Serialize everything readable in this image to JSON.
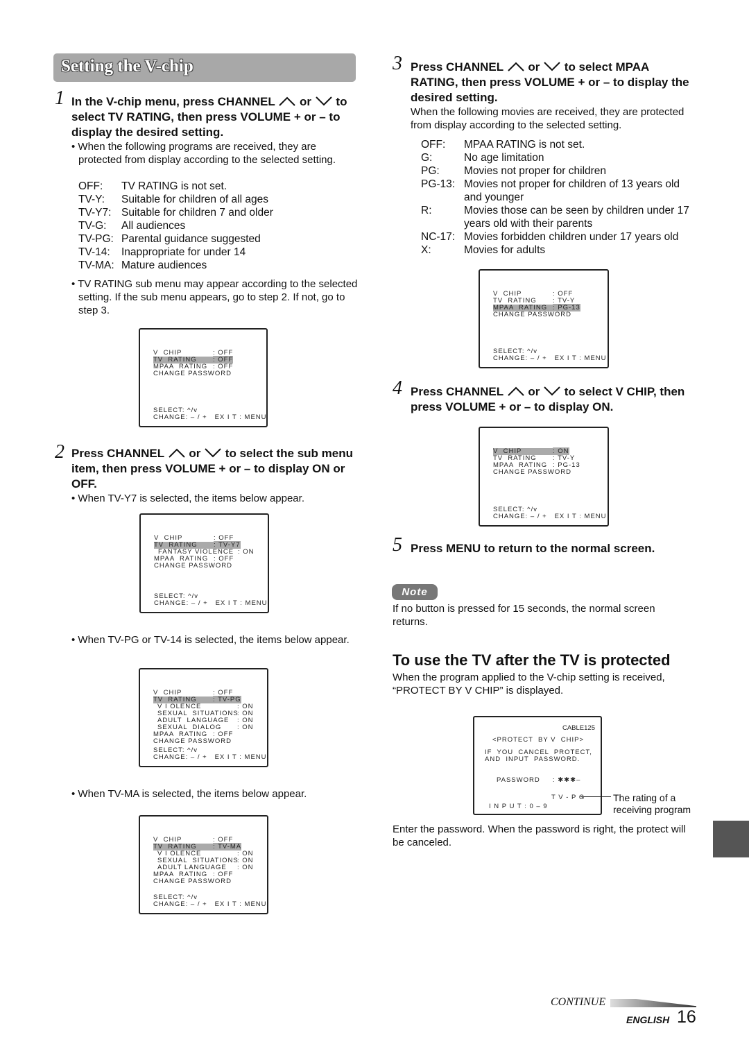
{
  "title": "Setting the V-chip",
  "left": {
    "step1": {
      "num": "1",
      "pre": "In the V-chip menu, press CHANNEL",
      "or": "or",
      "post": "to select TV RATING, then press VOLUME + or – to display the desired setting."
    },
    "step1_bullet1": "• When the following programs are received, they are protected from display according to the selected setting.",
    "tv_ratings": [
      {
        "k": "OFF:",
        "v": "TV RATING is not set."
      },
      {
        "k": "TV-Y:",
        "v": "Suitable for children of all ages"
      },
      {
        "k": "TV-Y7:",
        "v": "Suitable for children 7 and older"
      },
      {
        "k": "TV-G:",
        "v": "All audiences"
      },
      {
        "k": "TV-PG:",
        "v": "Parental guidance suggested"
      },
      {
        "k": "TV-14:",
        "v": "Inappropriate for under 14"
      },
      {
        "k": "TV-MA:",
        "v": "Mature audiences"
      }
    ],
    "step1_bullet2": "• TV RATING sub menu may appear according to the selected setting. If the sub menu appears, go to step 2. If not, go to step 3.",
    "step2": {
      "num": "2",
      "pre": "Press CHANNEL",
      "or": "or",
      "post": "to select the sub menu item, then press VOLUME + or – to display ON or OFF."
    },
    "step2_bullet1": "• When TV-Y7 is selected, the items below appear.",
    "step2_bullet2": "• When TV-PG or TV-14 is selected, the items below appear.",
    "step2_bullet3": "• When TV-MA is selected, the items below appear."
  },
  "right": {
    "step3": {
      "num": "3",
      "pre": "Press CHANNEL",
      "or": "or",
      "post": "to select MPAA RATING, then press VOLUME + or – to display the desired setting."
    },
    "step3_text": "When the following movies are received, they are protected from display according to the selected setting.",
    "mpaa_ratings": [
      {
        "k": "OFF:",
        "v": "MPAA RATING is not set."
      },
      {
        "k": "G:",
        "v": "No age limitation"
      },
      {
        "k": "PG:",
        "v": "Movies not proper for children"
      },
      {
        "k": "PG-13:",
        "v": "Movies not proper for children of 13 years old and younger"
      },
      {
        "k": "R:",
        "v": "Movies those can be seen by children under 17 years old with their parents"
      },
      {
        "k": "NC-17:",
        "v": "Movies forbidden children under 17 years old"
      },
      {
        "k": "X:",
        "v": "Movies for adults"
      }
    ],
    "step4": {
      "num": "4",
      "pre": "Press CHANNEL",
      "or": "or",
      "post": "to select V CHIP, then press VOLUME + or – to display ON."
    },
    "step5": {
      "num": "5",
      "text": "Press MENU to return to the normal screen."
    },
    "note_label": "Note",
    "note_text": "If no button is pressed for 15 seconds, the normal screen returns.",
    "heading": "To use the TV after the TV is protected",
    "para1": "When the program applied to the V-chip setting is received, “PROTECT BY V CHIP” is displayed.",
    "protect_screen": {
      "channel": "CABLE125",
      "title": "<PROTECT  BY V  CHIP>",
      "msg1": "IF  YOU  CANCEL  PROTECT,",
      "msg2": "AND  INPUT  PASSWORD.",
      "password": "PASSWORD     : ✱✱✱–",
      "rating": "T V - P G",
      "input": "I N P U T : 0 – 9"
    },
    "caption": "The rating of a receiving program",
    "para2": "Enter the password. When the password is right, the protect will be canceled."
  },
  "screen_footer": {
    "select": "SELECT: ^/v",
    "change": "CHANGE: – / +   EX I T : MENU"
  },
  "screens": [
    [
      {
        "l": "V  CHIP",
        "v": ": OFF"
      },
      {
        "l": "TV  RATING",
        "v": ": OFF",
        "hl": true
      },
      {
        "l": "MPAA  RATING",
        "v": ": OFF"
      },
      {
        "l": "CHANGE PASSWORD",
        "v": ""
      }
    ],
    [
      {
        "l": "V  CHIP",
        "v": ": OFF"
      },
      {
        "l": "TV  RATING",
        "v": ": TV-Y7",
        "hl": true
      },
      {
        "l": "FANTASY VIOLENCE",
        "v": ": ON",
        "sub": true
      },
      {
        "l": "MPAA  RATING",
        "v": ": OFF"
      },
      {
        "l": "CHANGE PASSWORD",
        "v": ""
      }
    ],
    [
      {
        "l": "V  CHIP",
        "v": ": OFF"
      },
      {
        "l": "TV  RATING",
        "v": ": TV-PG",
        "hl": true
      },
      {
        "l": "V I OLENCE",
        "v": ": ON",
        "sub": true
      },
      {
        "l": "SEXUAL  SITUATIONS",
        "v": ": ON",
        "sub": true
      },
      {
        "l": "ADULT  LANGUAGE",
        "v": ": ON",
        "sub": true
      },
      {
        "l": "SEXUAL  DIALOG",
        "v": ": ON",
        "sub": true
      },
      {
        "l": "MPAA  RATING",
        "v": ": OFF"
      },
      {
        "l": "CHANGE PASSWORD",
        "v": ""
      }
    ],
    [
      {
        "l": "V  CHIP",
        "v": ": OFF"
      },
      {
        "l": "TV  RATING",
        "v": ": TV-MA",
        "hl": true
      },
      {
        "l": "V I OLENCE",
        "v": ": ON",
        "sub": true
      },
      {
        "l": "SEXUAL  SITUATIONS",
        "v": ": ON",
        "sub": true
      },
      {
        "l": "ADULT LANGUAGE",
        "v": ": ON",
        "sub": true
      },
      {
        "l": "MPAA  RATING",
        "v": ": OFF"
      },
      {
        "l": "CHANGE PASSWORD",
        "v": ""
      }
    ],
    [
      {
        "l": "V  CHIP",
        "v": ": OFF"
      },
      {
        "l": "TV  RATING",
        "v": ": TV-Y"
      },
      {
        "l": "MPAA  RATING",
        "v": ": PG-13",
        "hl": true
      },
      {
        "l": "CHANGE PASSWORD",
        "v": ""
      }
    ],
    [
      {
        "l": "V  CHIP",
        "v": ": ON",
        "hl": true
      },
      {
        "l": "TV  RATING",
        "v": ": TV-Y"
      },
      {
        "l": "MPAA  RATING",
        "v": ": PG-13"
      },
      {
        "l": "CHANGE PASSWORD",
        "v": ""
      }
    ]
  ],
  "footer": {
    "continue": "CONTINUE",
    "language": "ENGLISH",
    "page": "16"
  },
  "colors": {
    "title_bar": "#a8a8a8",
    "note_badge": "#777777",
    "side_tab": "#555555",
    "highlight": "#aaaaaa"
  }
}
